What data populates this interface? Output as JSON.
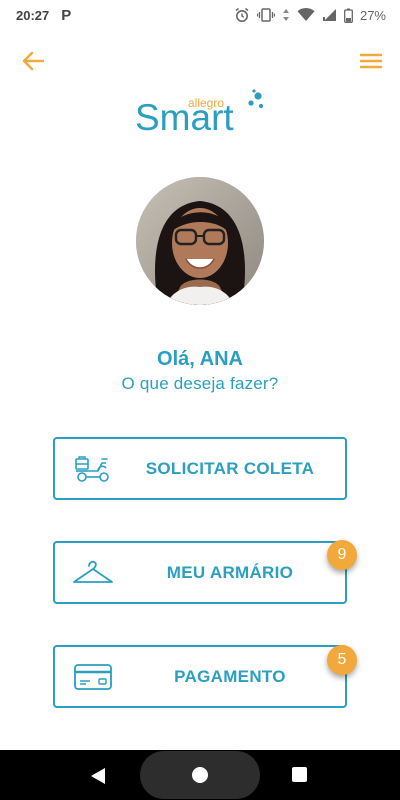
{
  "status_bar": {
    "time": "20:27",
    "app_badge": "P",
    "battery": "27%"
  },
  "app_bar": {
    "back_icon": "arrow-left-icon",
    "menu_icon": "hamburger-menu-icon"
  },
  "logo": {
    "main": "Smart",
    "sub": "allegro"
  },
  "profile": {
    "avatar_alt": "user photo"
  },
  "greeting": {
    "title": "Olá, ANA",
    "subtitle": "O que deseja fazer?"
  },
  "actions": [
    {
      "label": "SOLICITAR COLETA",
      "icon": "delivery-scooter-icon",
      "badge": null
    },
    {
      "label": "MEU ARMÁRIO",
      "icon": "clothes-hanger-icon",
      "badge": "9"
    },
    {
      "label": "PAGAMENTO",
      "icon": "credit-card-icon",
      "badge": "5"
    }
  ],
  "colors": {
    "primary": "#2a9fc1",
    "accent": "#f0a93a",
    "badge": "#f0a93a"
  }
}
